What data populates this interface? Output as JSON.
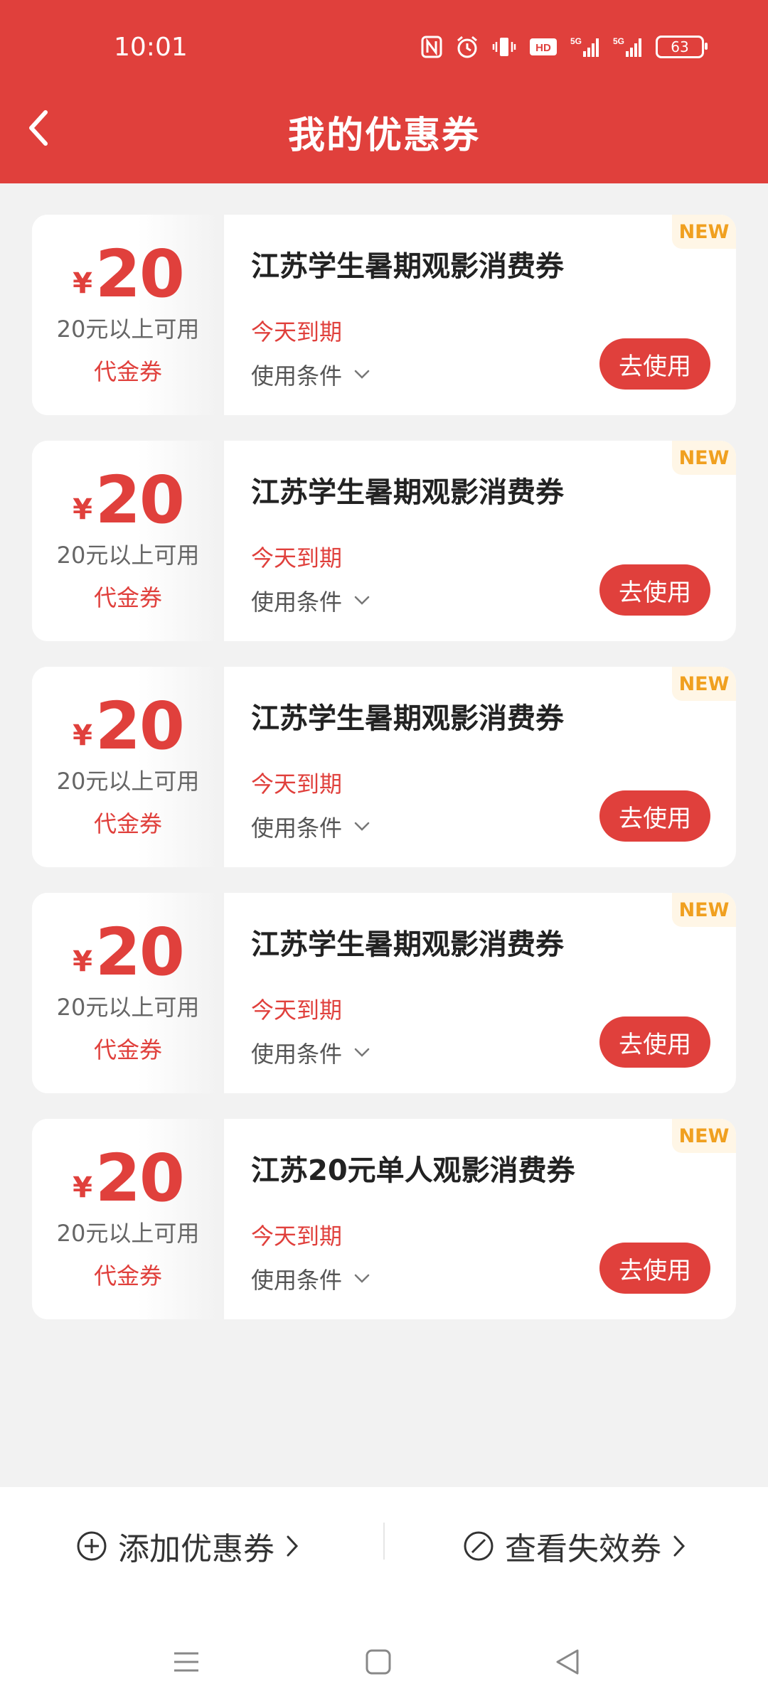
{
  "status_bar": {
    "time": "10:01",
    "battery": "63",
    "icons": [
      "nfc-icon",
      "alarm-icon",
      "vibrate-icon",
      "hd-icon",
      "signal-5g-icon",
      "signal-5g-icon",
      "battery-icon"
    ]
  },
  "header": {
    "title": "我的优惠券"
  },
  "colors": {
    "brand_red": "#e0403c",
    "badge_orange": "#f0a020",
    "background": "#f2f2f2"
  },
  "coupons": [
    {
      "currency": "¥",
      "amount": "20",
      "min_spend": "20元以上可用",
      "type": "代金券",
      "title": "江苏学生暑期观影消费券",
      "expiry": "今天到期",
      "conditions": "使用条件",
      "button": "去使用",
      "badge": "NEW"
    },
    {
      "currency": "¥",
      "amount": "20",
      "min_spend": "20元以上可用",
      "type": "代金券",
      "title": "江苏学生暑期观影消费券",
      "expiry": "今天到期",
      "conditions": "使用条件",
      "button": "去使用",
      "badge": "NEW"
    },
    {
      "currency": "¥",
      "amount": "20",
      "min_spend": "20元以上可用",
      "type": "代金券",
      "title": "江苏学生暑期观影消费券",
      "expiry": "今天到期",
      "conditions": "使用条件",
      "button": "去使用",
      "badge": "NEW"
    },
    {
      "currency": "¥",
      "amount": "20",
      "min_spend": "20元以上可用",
      "type": "代金券",
      "title": "江苏学生暑期观影消费券",
      "expiry": "今天到期",
      "conditions": "使用条件",
      "button": "去使用",
      "badge": "NEW"
    },
    {
      "currency": "¥",
      "amount": "20",
      "min_spend": "20元以上可用",
      "type": "代金券",
      "title": "江苏20元单人观影消费券",
      "expiry": "今天到期",
      "conditions": "使用条件",
      "button": "去使用",
      "badge": "NEW"
    }
  ],
  "bottom_bar": {
    "add_label": "添加优惠券",
    "invalid_label": "查看失效券"
  },
  "nav": {
    "items": [
      "menu-icon",
      "home-icon",
      "back-icon"
    ]
  }
}
